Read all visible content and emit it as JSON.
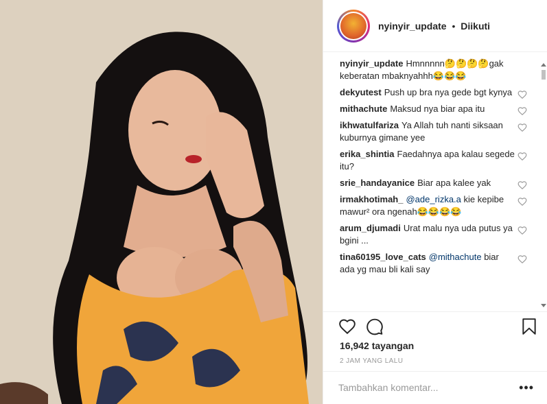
{
  "header": {
    "username": "nyinyir_update",
    "separator": "•",
    "follow_status": "Diikuti"
  },
  "comments": [
    {
      "user": "nyinyir_update",
      "mention": "",
      "text": "Hmnnnnn🤔🤔🤔🤔gak keberatan mbaknyahhh😂😂😂",
      "has_heart": false
    },
    {
      "user": "dekyutest",
      "mention": "",
      "text": "Push up bra nya gede bgt kynya",
      "has_heart": true
    },
    {
      "user": "mithachute",
      "mention": "",
      "text": "Maksud nya biar apa itu",
      "has_heart": true
    },
    {
      "user": "ikhwatulfariza",
      "mention": "",
      "text": "Ya Allah tuh nanti siksaan kuburnya gimane yee",
      "has_heart": true
    },
    {
      "user": "erika_shintia",
      "mention": "",
      "text": "Faedahnya apa kalau segede itu?",
      "has_heart": true
    },
    {
      "user": "srie_handayanice",
      "mention": "",
      "text": "Biar apa kalee yak",
      "has_heart": true
    },
    {
      "user": "irmakhotimah_",
      "mention": "@ade_rizka.a",
      "text": "kie kepibe mawur² ora ngenah😂😂😂😂",
      "has_heart": true
    },
    {
      "user": "arum_djumadi",
      "mention": "",
      "text": "Urat malu nya uda putus ya bgini ...",
      "has_heart": true
    },
    {
      "user": "tina60195_love_cats",
      "mention": "@mithachute",
      "text": "biar ada yg mau bli kali say",
      "has_heart": true
    }
  ],
  "actions": {
    "like_icon": "heart-outline-icon",
    "comment_icon": "speech-bubble-icon",
    "save_icon": "bookmark-icon"
  },
  "stats": {
    "views": "16,942 tayangan",
    "time": "2 JAM YANG LALU"
  },
  "comment_box": {
    "placeholder": "Tambahkan komentar...",
    "more_label": "•••"
  },
  "colors": {
    "text": "#262626",
    "muted": "#999999",
    "mention": "#003569",
    "border": "#efefef"
  }
}
